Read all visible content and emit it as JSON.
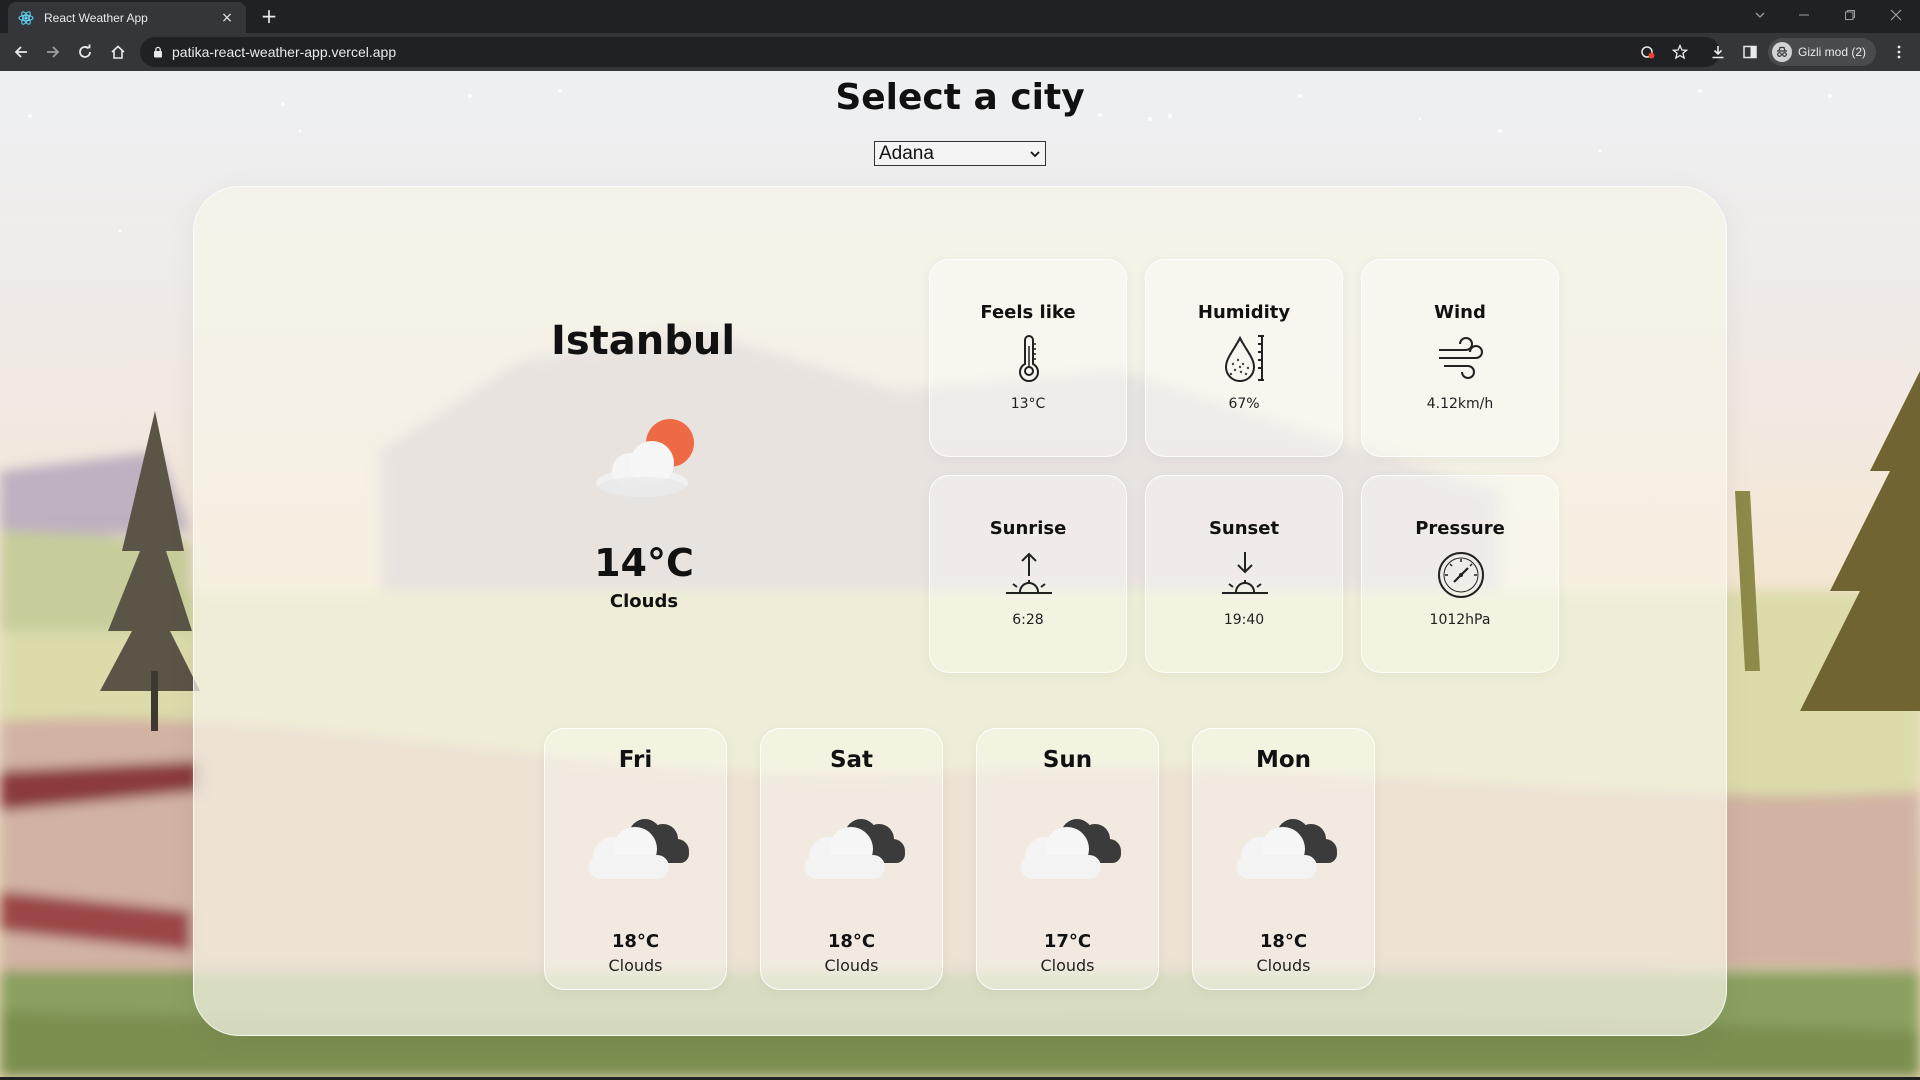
{
  "browser": {
    "tab_title": "React Weather App",
    "tab_close": "×",
    "new_tab": "+",
    "url": "patika-react-weather-app.vercel.app",
    "profile_label": "Gizli mod (2)"
  },
  "page": {
    "heading": "Select a city",
    "city_select": {
      "selected": "Adana"
    }
  },
  "current": {
    "city": "Istanbul",
    "icon": "partly-cloudy-sun-icon",
    "temperature": "14°C",
    "description": "Clouds"
  },
  "stats": [
    {
      "title": "Feels like",
      "icon": "thermometer-icon",
      "value": "13°C"
    },
    {
      "title": "Humidity",
      "icon": "humidity-drop-icon",
      "value": "67%"
    },
    {
      "title": "Wind",
      "icon": "wind-icon",
      "value": "4.12km/h"
    },
    {
      "title": "Sunrise",
      "icon": "sunrise-icon",
      "value": "6:28"
    },
    {
      "title": "Sunset",
      "icon": "sunset-icon",
      "value": "19:40"
    },
    {
      "title": "Pressure",
      "icon": "barometer-icon",
      "value": "1012hPa"
    }
  ],
  "forecast": [
    {
      "day": "Fri",
      "icon": "clouds-icon",
      "temp": "18°C",
      "desc": "Clouds"
    },
    {
      "day": "Sat",
      "icon": "clouds-icon",
      "temp": "18°C",
      "desc": "Clouds"
    },
    {
      "day": "Sun",
      "icon": "clouds-icon",
      "temp": "17°C",
      "desc": "Clouds"
    },
    {
      "day": "Mon",
      "icon": "clouds-icon",
      "temp": "18°C",
      "desc": "Clouds"
    }
  ],
  "colors": {
    "chrome_dark": "#202124",
    "chrome_toolbar": "#35363a",
    "sun_orange": "#ee6a45",
    "cloud_dark": "#3b3b3b"
  }
}
